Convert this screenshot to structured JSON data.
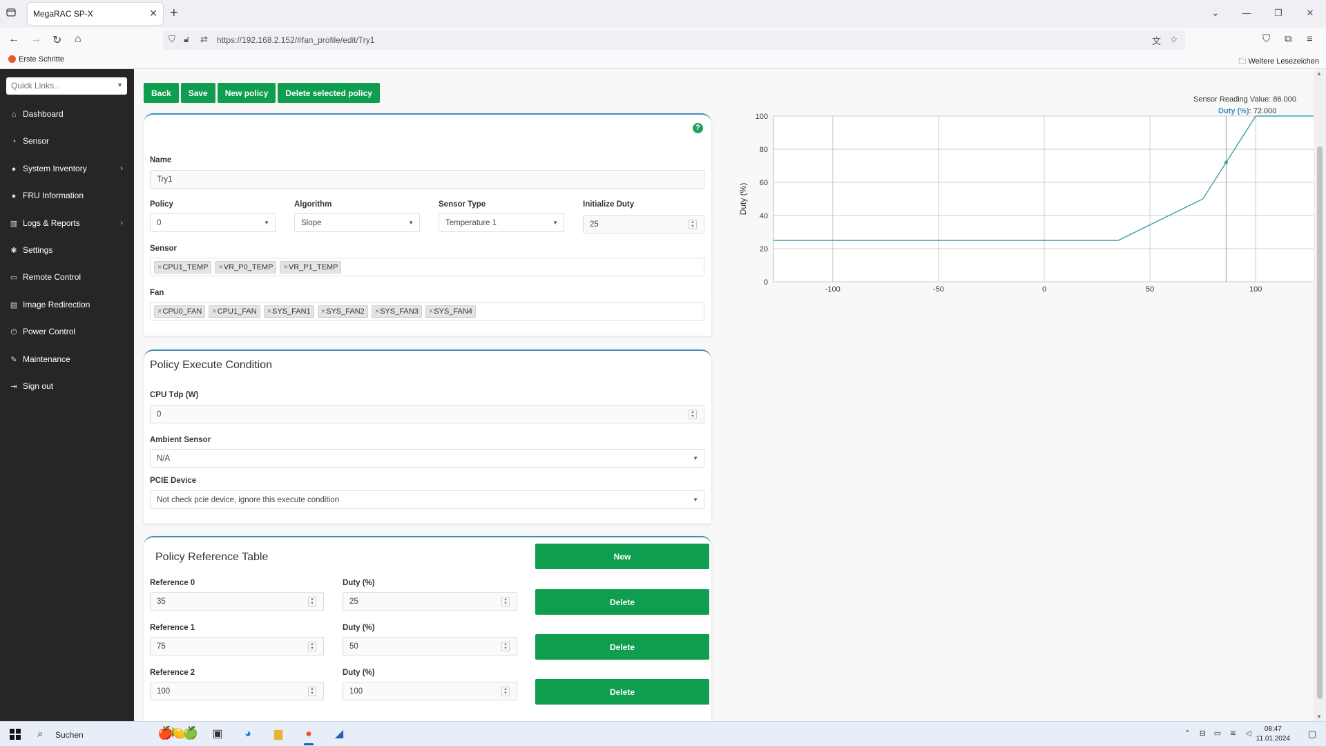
{
  "browser": {
    "tab_title": "MegaRAC SP-X",
    "url": "https://192.168.2.152/#fan_profile/edit/Try1",
    "bookmark_first": "Erste Schritte",
    "bookmark_more": "Weitere Lesezeichen"
  },
  "sidebar": {
    "quicklinks_placeholder": "Quick Links..",
    "items": [
      {
        "label": "Dashboard",
        "icon": "home-icon",
        "glyph": "⌂",
        "has_arrow": false
      },
      {
        "label": "Sensor",
        "icon": "sensor-icon",
        "glyph": "◔",
        "has_arrow": false
      },
      {
        "label": "System Inventory",
        "icon": "info-icon",
        "glyph": "●",
        "has_arrow": true
      },
      {
        "label": "FRU Information",
        "icon": "info-icon",
        "glyph": "●",
        "has_arrow": false
      },
      {
        "label": "Logs & Reports",
        "icon": "bar-chart-icon",
        "glyph": "▥",
        "has_arrow": true
      },
      {
        "label": "Settings",
        "icon": "gear-icon",
        "glyph": "✱",
        "has_arrow": false
      },
      {
        "label": "Remote Control",
        "icon": "monitor-icon",
        "glyph": "▭",
        "has_arrow": false
      },
      {
        "label": "Image Redirection",
        "icon": "hdd-icon",
        "glyph": "▤",
        "has_arrow": false
      },
      {
        "label": "Power Control",
        "icon": "power-icon",
        "glyph": "⏻",
        "has_arrow": false
      },
      {
        "label": "Maintenance",
        "icon": "wrench-icon",
        "glyph": "✎",
        "has_arrow": false
      },
      {
        "label": "Sign out",
        "icon": "sign-out-icon",
        "glyph": "⇥",
        "has_arrow": false
      }
    ]
  },
  "toolbar": {
    "back": "Back",
    "save": "Save",
    "new_policy": "New policy",
    "delete_policy": "Delete selected policy"
  },
  "form": {
    "name_label": "Name",
    "name_value": "Try1",
    "policy_label": "Policy",
    "policy_value": "0",
    "algorithm_label": "Algorithm",
    "algorithm_value": "Slope",
    "sensor_type_label": "Sensor Type",
    "sensor_type_value": "Temperature 1",
    "init_duty_label": "Initialize Duty",
    "init_duty_value": "25",
    "sensor_label": "Sensor",
    "sensors": [
      "CPU1_TEMP",
      "VR_P0_TEMP",
      "VR_P1_TEMP"
    ],
    "fan_label": "Fan",
    "fans": [
      "CPU0_FAN",
      "CPU1_FAN",
      "SYS_FAN1",
      "SYS_FAN2",
      "SYS_FAN3",
      "SYS_FAN4"
    ]
  },
  "condition": {
    "title": "Policy Execute Condition",
    "cpu_tdp_label": "CPU Tdp (W)",
    "cpu_tdp_value": "0",
    "ambient_label": "Ambient Sensor",
    "ambient_value": "N/A",
    "pcie_label": "PCIE Device",
    "pcie_value": "Not check pcie device, ignore this execute condition"
  },
  "reference_table": {
    "title": "Policy Reference Table",
    "new_label": "New",
    "delete_label": "Delete",
    "duty_label": "Duty (%)",
    "rows": [
      {
        "ref_label": "Reference 0",
        "ref_value": "35",
        "duty_value": "25"
      },
      {
        "ref_label": "Reference 1",
        "ref_value": "75",
        "duty_value": "50"
      },
      {
        "ref_label": "Reference 2",
        "ref_value": "100",
        "duty_value": "100"
      }
    ]
  },
  "chart_data": {
    "type": "line",
    "xlabel": "Sensor Reading Value",
    "ylabel": "Duty (%)",
    "xlim": [
      -128,
      128
    ],
    "ylim": [
      0,
      100
    ],
    "xticks": [
      -100,
      -50,
      0,
      50,
      100
    ],
    "yticks": [
      0,
      20,
      40,
      60,
      80,
      100
    ],
    "grid": true,
    "color": "#3aa0a5",
    "series": [
      {
        "x": [
          -128,
          35,
          75,
          100,
          128
        ],
        "y": [
          25,
          25,
          50,
          100,
          100
        ]
      }
    ],
    "highlight": {
      "x": 86,
      "y": 72
    },
    "tooltip_reading": "Sensor Reading Value: 86.000",
    "tooltip_duty_label": "Duty (%)",
    "tooltip_duty_value": ": 72.000"
  },
  "taskbar": {
    "search_label": "Suchen",
    "time": "08:47",
    "date": "11.01.2024"
  }
}
